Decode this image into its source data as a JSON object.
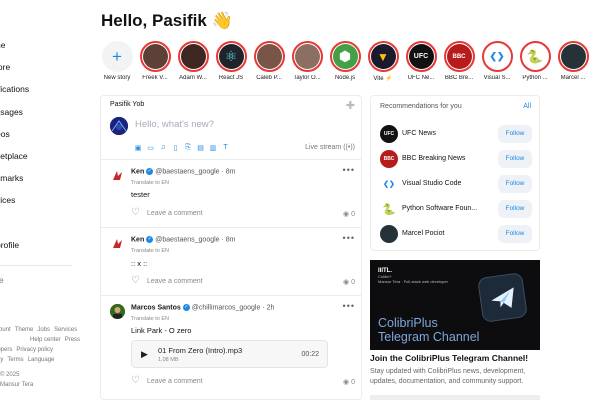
{
  "sidebar": {
    "items": [
      "ne",
      "lore",
      "ifications",
      "ssages",
      "eos",
      "ketplace",
      "kmarks",
      "vices",
      "s",
      "profile"
    ],
    "more": "re",
    "footer": {
      "row1": [
        "count",
        "Theme",
        "Jobs",
        "Services"
      ],
      "row2": [
        "Help center",
        "Press"
      ],
      "row3": [
        "lopers",
        "Privacy policy"
      ],
      "row4": [
        "icy",
        "Terms",
        "Language"
      ],
      "row5": "© 2025",
      "row6": "Mansur Tera"
    }
  },
  "greeting": {
    "text": "Hello, Pasifik",
    "emoji": "👋"
  },
  "stories": [
    {
      "label": "New story",
      "kind": "new",
      "icon": "+"
    },
    {
      "label": "Freek V...",
      "color": "#5d4037"
    },
    {
      "label": "Adam W...",
      "color": "#3e2723"
    },
    {
      "label": "React JS",
      "color": "#20232a",
      "icon": "⚛"
    },
    {
      "label": "Caleb P...",
      "color": "#795548"
    },
    {
      "label": "Taylor O...",
      "color": "#8d6e63"
    },
    {
      "label": "Node.js",
      "color": "#43a047",
      "icon": "⬢"
    },
    {
      "label": "Vite ⚡",
      "color": "#1a1a2e",
      "icon": "▼"
    },
    {
      "label": "UFC Ne...",
      "color": "#111111",
      "icon": "UFC"
    },
    {
      "label": "BBC Bre...",
      "color": "#b71c1c",
      "icon": "BBC"
    },
    {
      "label": "Visual S...",
      "color": "#ffffff",
      "icon": "❮❯"
    },
    {
      "label": "Python ...",
      "color": "#ffffff",
      "icon": "🐍"
    },
    {
      "label": "Marcel ...",
      "color": "#263238"
    }
  ],
  "composer": {
    "user": "Pasifik Yob",
    "placeholder": "Hello, what's new?",
    "live": "Live stream",
    "tools": [
      "▣",
      "▭",
      "♫",
      "▯",
      "⎘",
      "▤",
      "▥",
      "T"
    ]
  },
  "posts": [
    {
      "name": "Ken",
      "handle": "@baestaens_google · 8m",
      "translate": "Translate to EN",
      "text": "tester",
      "comment": "Leave a comment",
      "views": "0"
    },
    {
      "name": "Ken",
      "handle": "@baestaens_google · 8m",
      "translate": "Translate to EN",
      "text": ":: x ::",
      "comment": "Leave a comment",
      "views": "0"
    },
    {
      "name": "Marcos Santos",
      "handle": "@chillimarcos_google · 2h",
      "translate": "Translate to EN",
      "text": "Link Park - O zero",
      "audio": {
        "title": "01 From Zero (Intro).mp3",
        "size": "1.08 MB",
        "duration": "00:22"
      },
      "comment": "Leave a comment",
      "views": "0"
    }
  ],
  "recommendations": {
    "heading": "Recommendations for you",
    "all": "All",
    "items": [
      {
        "name": "UFC News",
        "avatar": "UFC",
        "color": "#111111",
        "follow": "Follow"
      },
      {
        "name": "BBC Breaking News",
        "avatar": "BBC",
        "color": "#b71c1c",
        "follow": "Follow"
      },
      {
        "name": "Visual Studio Code",
        "avatar": "❮❯",
        "color": "#ffffff",
        "follow": "Follow"
      },
      {
        "name": "Python Software Foun...",
        "avatar": "🐍",
        "color": "#ffffff",
        "follow": "Follow"
      },
      {
        "name": "Marcel Pociot",
        "avatar": "",
        "color": "#263238",
        "follow": "Follow"
      }
    ]
  },
  "banner": {
    "brand": "IIITL.",
    "mini1": "Colibri+",
    "mini2": "Mansur Tera · Full-stack web developer",
    "line1": "ColibriPlus",
    "line2": "Telegram Channel",
    "title": "Join the ColibriPlus Telegram Channel!",
    "desc": "Stay updated with ColibriPlus news, development, updates, documentation, and community support."
  }
}
